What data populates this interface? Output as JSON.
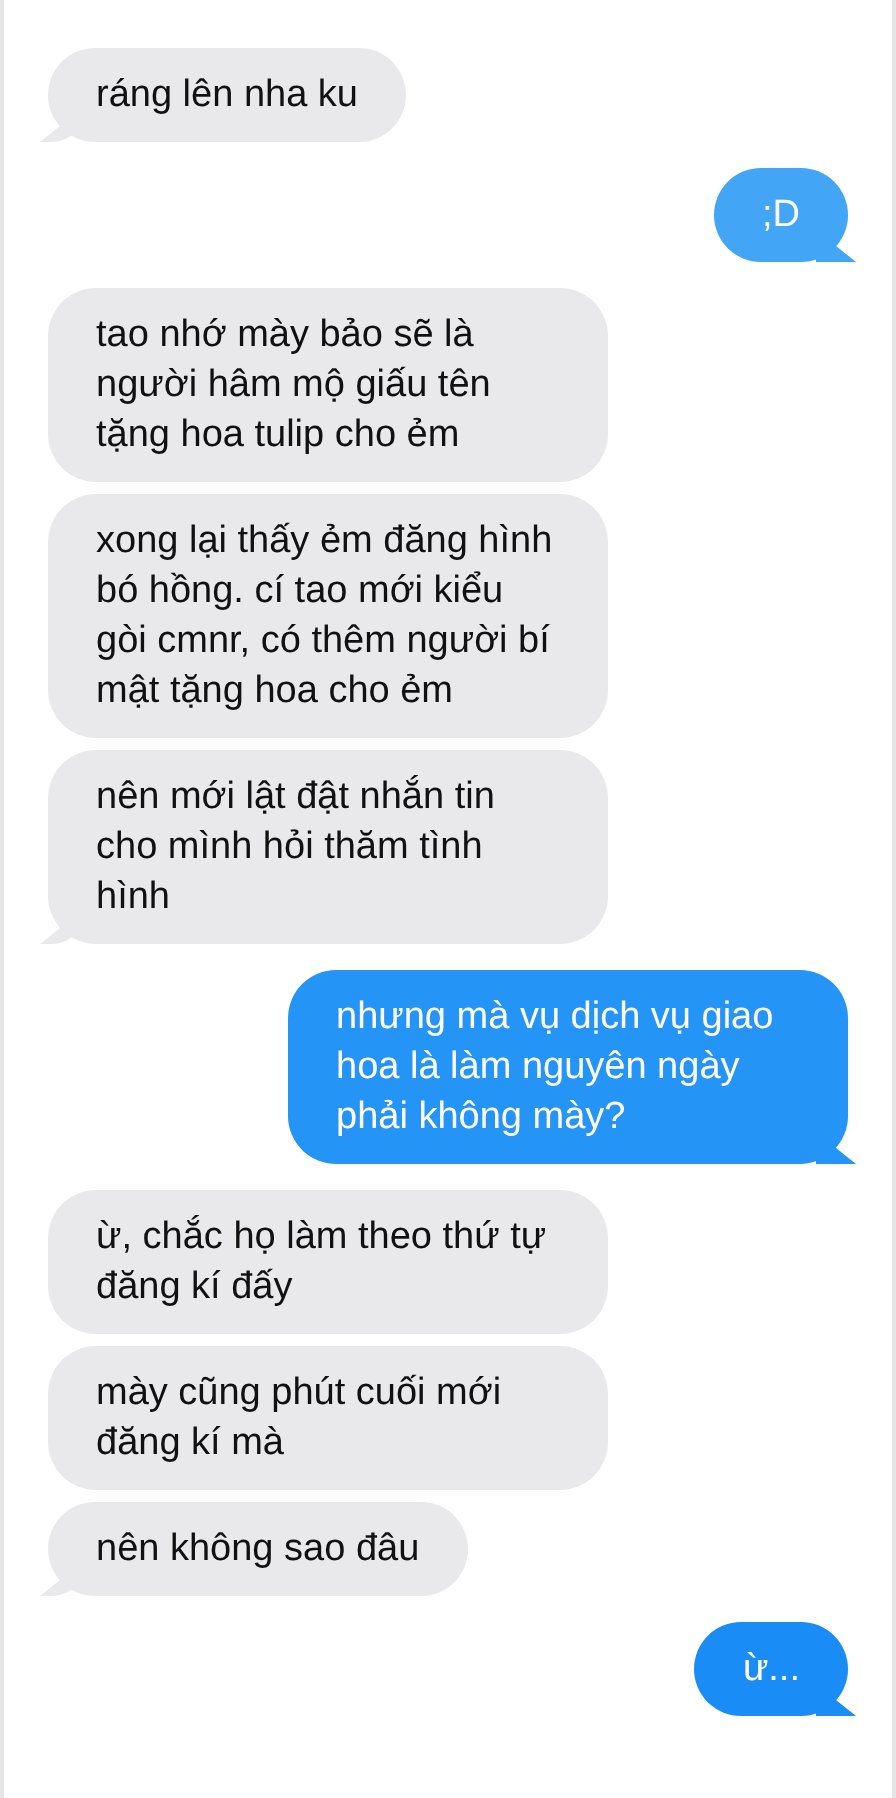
{
  "messages": [
    {
      "kind": "received",
      "text": "ráng lên nha ku",
      "tail": true
    },
    {
      "kind": "sent",
      "text": ";D",
      "tail": true,
      "color": "#42a5f5"
    },
    {
      "kind": "received",
      "text": "tao nhớ mày bảo sẽ là người hâm mộ giấu tên tặng hoa tulip cho ẻm",
      "tail": false
    },
    {
      "kind": "received",
      "text": "xong lại thấy ẻm đăng hình bó hồng. cí tao mới kiểu gòi cmnr, có thêm người bí mật tặng hoa cho ẻm",
      "tail": false
    },
    {
      "kind": "received",
      "text": "nên mới lật đật nhắn tin cho mình hỏi thăm tình hình",
      "tail": true
    },
    {
      "kind": "sent",
      "text": "nhưng mà vụ dịch vụ giao hoa là làm nguyên ngày phải không mày?",
      "tail": true,
      "color": "#2594f7"
    },
    {
      "kind": "received",
      "text": "ừ, chắc họ làm theo thứ tự đăng kí đấy",
      "tail": false
    },
    {
      "kind": "received",
      "text": "mày cũng phút cuối mới đăng kí mà",
      "tail": false
    },
    {
      "kind": "received",
      "text": "nên không sao đâu",
      "tail": true
    },
    {
      "kind": "sent",
      "text": "ừ...",
      "tail": true,
      "color": "#1a8cf5"
    }
  ]
}
